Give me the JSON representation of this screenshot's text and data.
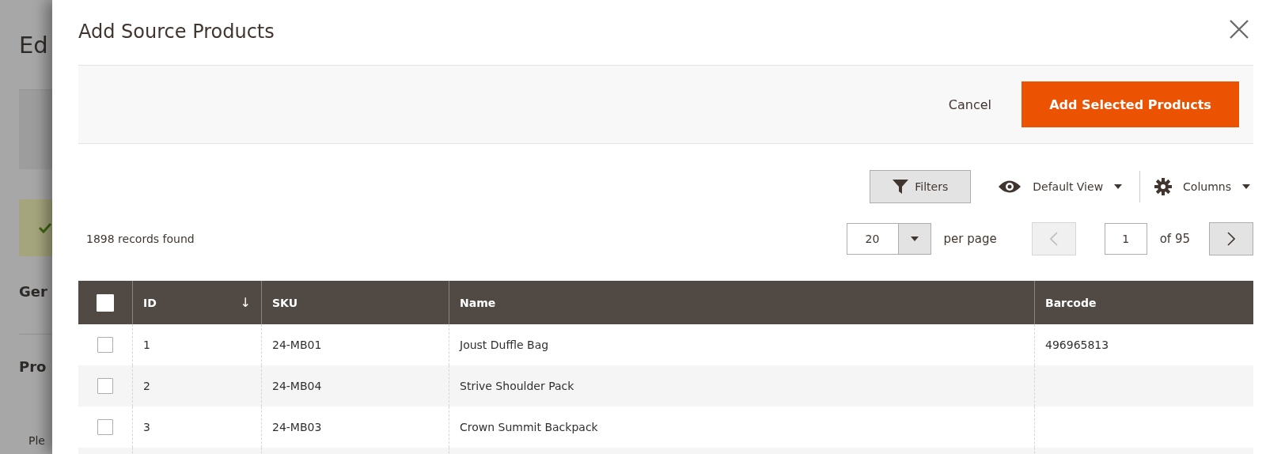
{
  "background_page": {
    "title": "Ed",
    "sections": [
      "Ger",
      "Pro"
    ],
    "note": "Ple"
  },
  "modal": {
    "title": "Add Source Products",
    "actions": [
      {
        "kind": "link",
        "label": "Cancel"
      },
      {
        "kind": "primary",
        "label": "Add Selected Products"
      }
    ],
    "toolbar": {
      "filters": "Filters",
      "view": "Default View",
      "columns": "Columns"
    },
    "records": "1898 records found",
    "pager": {
      "per_page_value": "20",
      "per_page_label": "per page",
      "prev_disabled": true,
      "page": "1",
      "total": "of 95",
      "next_disabled": false
    },
    "table": {
      "select_all_checked": false,
      "columns": [
        {
          "label": "ID",
          "sort_mark": "↓"
        },
        {
          "label": "SKU"
        },
        {
          "label": "Name"
        },
        {
          "label": "Barcode"
        }
      ],
      "rows": [
        {
          "checked": false,
          "cells": [
            "1",
            "24-MB01",
            "Joust Duffle Bag",
            "496965813"
          ]
        },
        {
          "checked": false,
          "cells": [
            "2",
            "24-MB04",
            "Strive Shoulder Pack",
            ""
          ]
        },
        {
          "checked": false,
          "cells": [
            "3",
            "24-MB03",
            "Crown Summit Backpack",
            ""
          ]
        }
      ]
    }
  }
}
